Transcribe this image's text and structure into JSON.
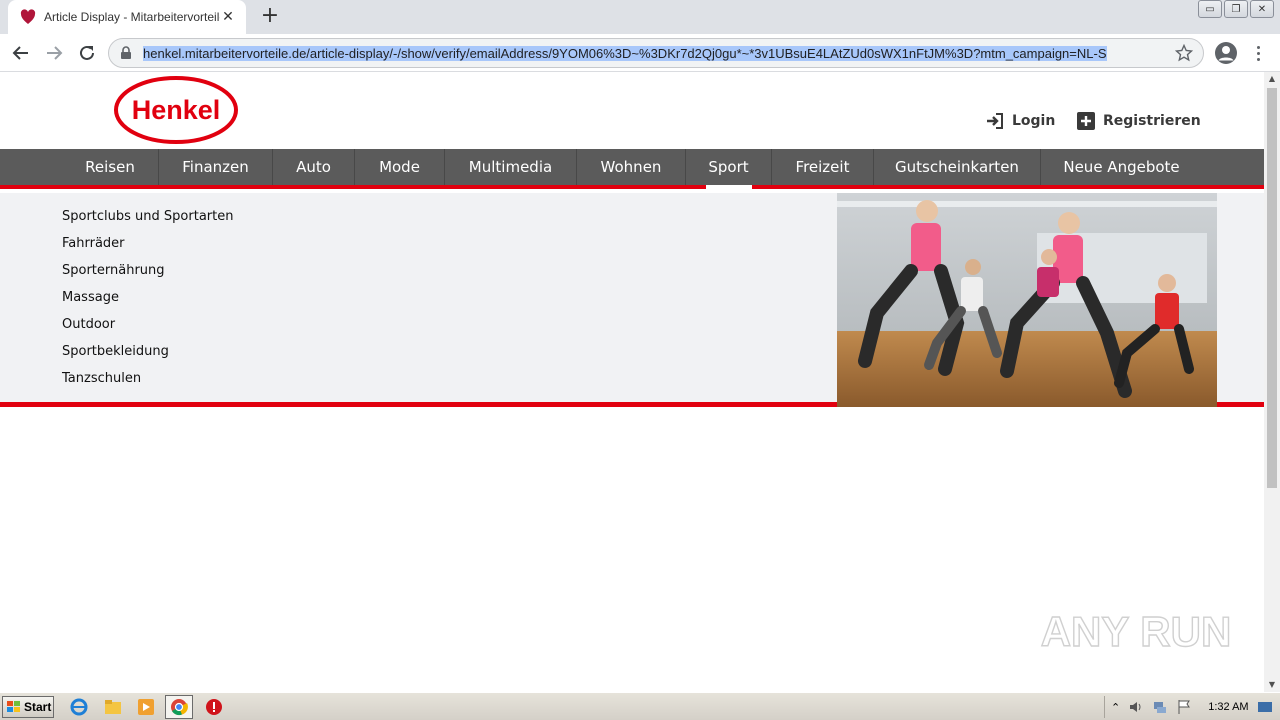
{
  "browser": {
    "tab_title": "Article Display - Mitarbeitervorteile",
    "tab_close": "✕",
    "new_tab": "+",
    "url_highlighted": "henkel.mitarbeitervorteile.de/article-display/-/show/verify/emailAddress/9YOM06%3D~%3DKr7d2Qj0gu*~*3v1UBsuE4LAtZUd0sWX1nFtJM%3D?mtm_campaign=NL-S",
    "window_controls": [
      "▭",
      "❐",
      "✕"
    ]
  },
  "site": {
    "logo_text": "Henkel",
    "brand_red": "#e1000f",
    "nav_bg": "#5b5b5b",
    "login_label": "Login",
    "register_label": "Registrieren",
    "nav_items": [
      "Reisen",
      "Finanzen",
      "Auto",
      "Mode",
      "Multimedia",
      "Wohnen",
      "Sport",
      "Freizeit",
      "Gutscheinkarten",
      "Neue Angebote"
    ],
    "active_nav": "Sport",
    "sport_subcategories": [
      "Sportclubs und Sportarten",
      "Fahrräder",
      "Sporternährung",
      "Massage",
      "Outdoor",
      "Sportbekleidung",
      "Tanzschulen"
    ]
  },
  "watermark": "ANY RUN",
  "taskbar": {
    "start_label": "Start",
    "clock": "1:32 AM"
  }
}
